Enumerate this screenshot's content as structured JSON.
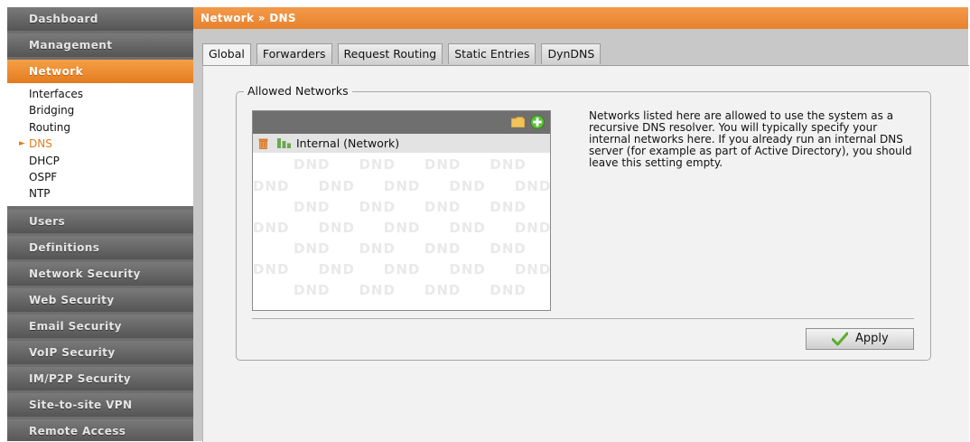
{
  "sidebar": {
    "top_items": [
      "Dashboard",
      "Management"
    ],
    "active_item": "Network",
    "sub_items": [
      "Interfaces",
      "Bridging",
      "Routing",
      "DNS",
      "DHCP",
      "OSPF",
      "NTP"
    ],
    "active_sub_item": "DNS",
    "bottom_items": [
      "Users",
      "Definitions",
      "Network Security",
      "Web Security",
      "Email Security",
      "VoIP Security",
      "IM/P2P Security",
      "Site-to-site VPN",
      "Remote Access"
    ]
  },
  "header": {
    "breadcrumb": "Network » DNS"
  },
  "tabs": [
    "Global",
    "Forwarders",
    "Request Routing",
    "Static Entries",
    "DynDNS"
  ],
  "active_tab": "Global",
  "allowed_networks": {
    "legend": "Allowed Networks",
    "items": [
      {
        "label": "Internal (Network)"
      }
    ],
    "help": "Networks listed here are allowed to use the system as a recursive DNS resolver. You will typically specify your internal networks here. If you already run an internal DNS server (for example as part of Active Directory), you should leave this setting empty.",
    "watermark": "DND"
  },
  "apply_label": "Apply",
  "colors": {
    "accent": "#e8822d",
    "sidebar": "#6e6e6e",
    "panel": "#f2f2f2"
  },
  "icons": [
    "folder-icon",
    "add-icon",
    "trash-icon",
    "network-icon",
    "check-icon"
  ]
}
